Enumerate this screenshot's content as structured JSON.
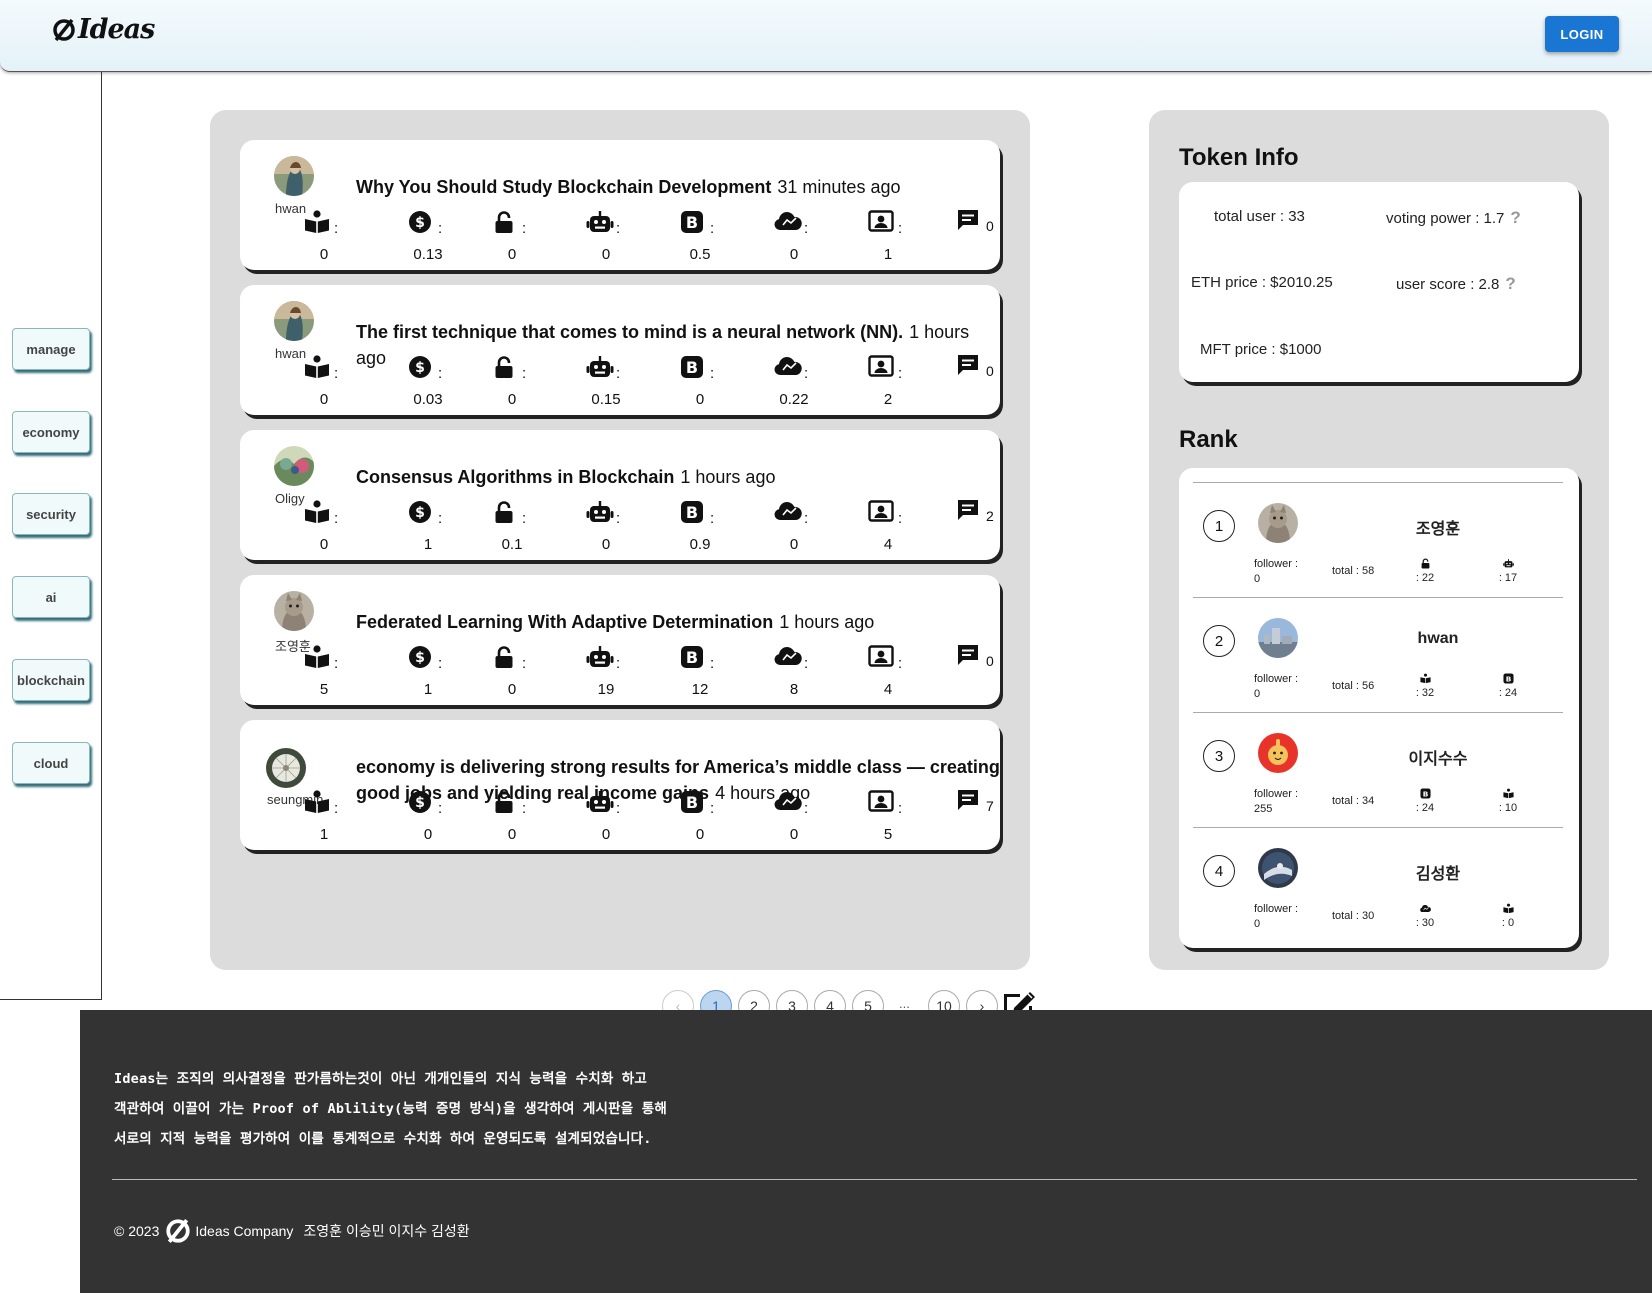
{
  "header": {
    "logo_text": "Ideas",
    "login_label": "LOGIN"
  },
  "sidebar": {
    "items": [
      {
        "label": "manage"
      },
      {
        "label": "economy"
      },
      {
        "label": "security"
      },
      {
        "label": "ai"
      },
      {
        "label": "blockchain"
      },
      {
        "label": "cloud"
      }
    ]
  },
  "posts": [
    {
      "author": "hwan",
      "title": "Why You Should Study Blockchain Development",
      "time": "31 minutes ago",
      "stats": [
        "0",
        "0.13",
        "0",
        "0",
        "0.5",
        "0",
        "1"
      ],
      "comments": "0"
    },
    {
      "author": "hwan",
      "title": "The first technique that comes to mind is a neural network (NN).",
      "time": "1 hours ago",
      "stats": [
        "0",
        "0.03",
        "0",
        "0.15",
        "0",
        "0.22",
        "2"
      ],
      "comments": "0"
    },
    {
      "author": "Oligy",
      "title": "Consensus Algorithms in Blockchain",
      "time": "1 hours ago",
      "stats": [
        "0",
        "1",
        "0.1",
        "0",
        "0.9",
        "0",
        "4"
      ],
      "comments": "2"
    },
    {
      "author": "조영훈",
      "title": "Federated Learning With Adaptive Determination",
      "time": "1 hours ago",
      "stats": [
        "5",
        "1",
        "0",
        "19",
        "12",
        "8",
        "4"
      ],
      "comments": "0"
    },
    {
      "author": "seungmin",
      "title": "economy is delivering strong results for America’s middle class — creating good jobs and yielding real income gains",
      "time": "4 hours ago",
      "stats": [
        "1",
        "0",
        "0",
        "0",
        "0",
        "0",
        "5"
      ],
      "comments": "7"
    }
  ],
  "stat_icons": [
    "book-icon",
    "dollar-coin-icon",
    "lock-icon",
    "robot-icon",
    "bitcoin-icon",
    "cloud-icon",
    "id-card-icon"
  ],
  "colon": ":",
  "pagination": {
    "prev": "‹",
    "pages": [
      "1",
      "2",
      "3",
      "4",
      "5"
    ],
    "ellipsis": "...",
    "last": "10",
    "next": "›",
    "current": "1"
  },
  "token_info": {
    "title": "Token Info",
    "total_user": "total user : 33",
    "voting_power": "voting power : 1.7",
    "eth_price": "ETH price : $2010.25",
    "user_score": "user score : 2.8",
    "mft_price": "MFT price : $1000",
    "help": "?"
  },
  "rank": {
    "title": "Rank",
    "rows": [
      {
        "num": "1",
        "name": "조영훈",
        "follower_label": "follower :",
        "follower": "0",
        "total": "total : 58",
        "s1_icon": "lock-icon",
        "s1": ": 22",
        "s2_icon": "robot-icon",
        "s2": ": 17"
      },
      {
        "num": "2",
        "name": "hwan",
        "follower_label": "follower :",
        "follower": "0",
        "total": "total : 56",
        "s1_icon": "book-icon",
        "s1": ": 32",
        "s2_icon": "bitcoin-icon",
        "s2": ": 24"
      },
      {
        "num": "3",
        "name": "이지수수",
        "follower_label": "follower :",
        "follower": "255",
        "total": "total : 34",
        "s1_icon": "bitcoin-icon",
        "s1": ": 24",
        "s2_icon": "book-icon",
        "s2": ": 10"
      },
      {
        "num": "4",
        "name": "김성환",
        "follower_label": "follower :",
        "follower": "0",
        "total": "total : 30",
        "s1_icon": "cloud-icon",
        "s1": ": 30",
        "s2_icon": "book-icon",
        "s2": ": 0"
      }
    ]
  },
  "footer": {
    "line1": "Ideas는 조직의 의사결정을 판가름하는것이 아닌 개개인들의 지식 능력을 수치화 하고",
    "line2": "객관하여 이끌어 가는 Proof of Ablility(능력 증명 방식)을 생각하여 게시판을 통해",
    "line3": "서로의 지적 능력을 평가하여 이를 통계적으로 수치화 하여 운영되도록 설계되었습니다.",
    "copyright": "© 2023",
    "company": "Ideas Company",
    "team": "조영훈 이승민 이지수 김성환"
  }
}
